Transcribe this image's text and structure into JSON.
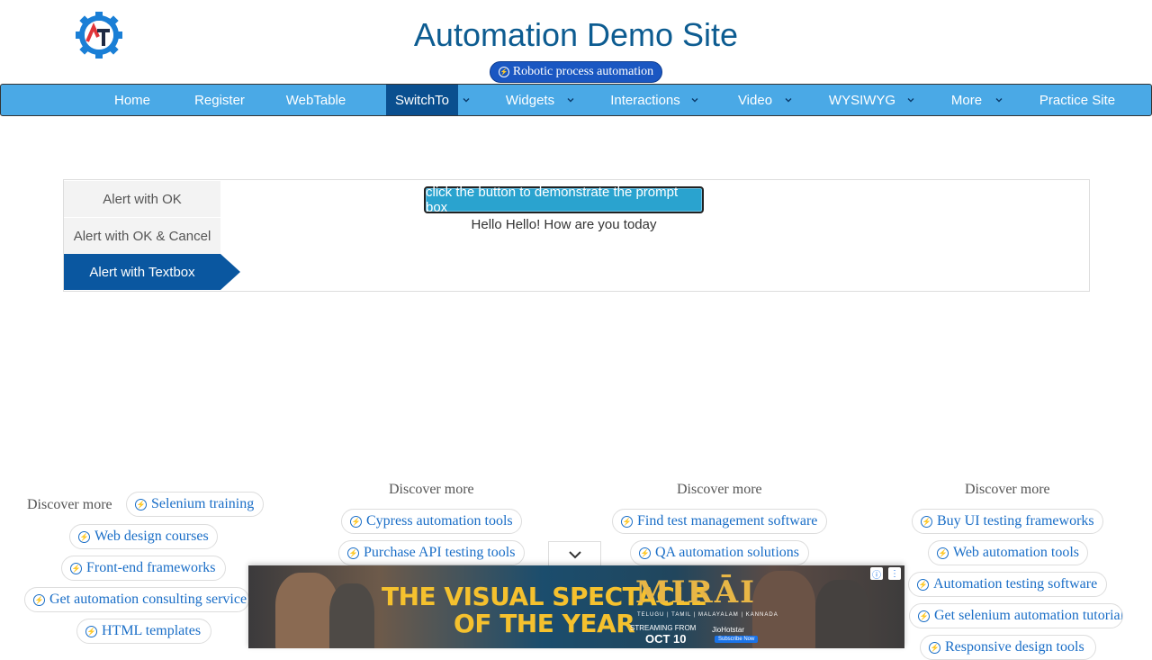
{
  "header": {
    "title": "Automation Demo Site",
    "rpa_link": "Robotic process automation"
  },
  "nav": {
    "items": [
      {
        "label": "Home",
        "has_dropdown": false
      },
      {
        "label": "Register",
        "has_dropdown": false
      },
      {
        "label": "WebTable",
        "has_dropdown": false
      },
      {
        "label": "SwitchTo",
        "has_dropdown": true,
        "active": true
      },
      {
        "label": "Widgets",
        "has_dropdown": true
      },
      {
        "label": "Interactions",
        "has_dropdown": true
      },
      {
        "label": "Video",
        "has_dropdown": true
      },
      {
        "label": "WYSIWYG",
        "has_dropdown": true
      },
      {
        "label": "More",
        "has_dropdown": true
      },
      {
        "label": "Practice Site",
        "has_dropdown": false
      }
    ]
  },
  "alerts": {
    "tabs": [
      "Alert with OK",
      "Alert with OK & Cancel",
      "Alert with Textbox"
    ],
    "active_tab": "Alert with Textbox",
    "prompt_button": "click the button to demonstrate the prompt box",
    "result_text": "Hello Hello! How are you today"
  },
  "discover": {
    "label": "Discover more",
    "col1": [
      "Selenium training",
      "Web design courses",
      "Front-end frameworks",
      "Get automation consulting service",
      "HTML templates"
    ],
    "col2": [
      "Cypress automation tools",
      "Purchase API testing tools"
    ],
    "col3": [
      "Find test management software",
      "QA automation solutions"
    ],
    "col4": [
      "Buy UI testing frameworks",
      "Web automation tools",
      "Automation testing software",
      "Get selenium automation tutorials",
      "Responsive design tools"
    ]
  },
  "ad": {
    "tagline_line1": "THE VISUAL SPECTACLE",
    "tagline_line2": "OF THE YEAR",
    "movie_title": "MIRĀI",
    "languages": "TELUGU | TAMIL | MALAYALAM | KANNADA",
    "streaming_label": "STREAMING FROM",
    "date": "OCT 10",
    "platform": "JioHotstar",
    "subscribe": "Subscribe Now",
    "info_icon": "info-icon",
    "menu_icon": "more-vert-icon"
  },
  "colors": {
    "title": "#0d5c91",
    "nav_bg": "#4aa9e6",
    "nav_active": "#0a4f8f",
    "tab_active": "#0a57a0",
    "prompt_button": "#2aa3cf",
    "chip_text": "#1a6ec7"
  }
}
